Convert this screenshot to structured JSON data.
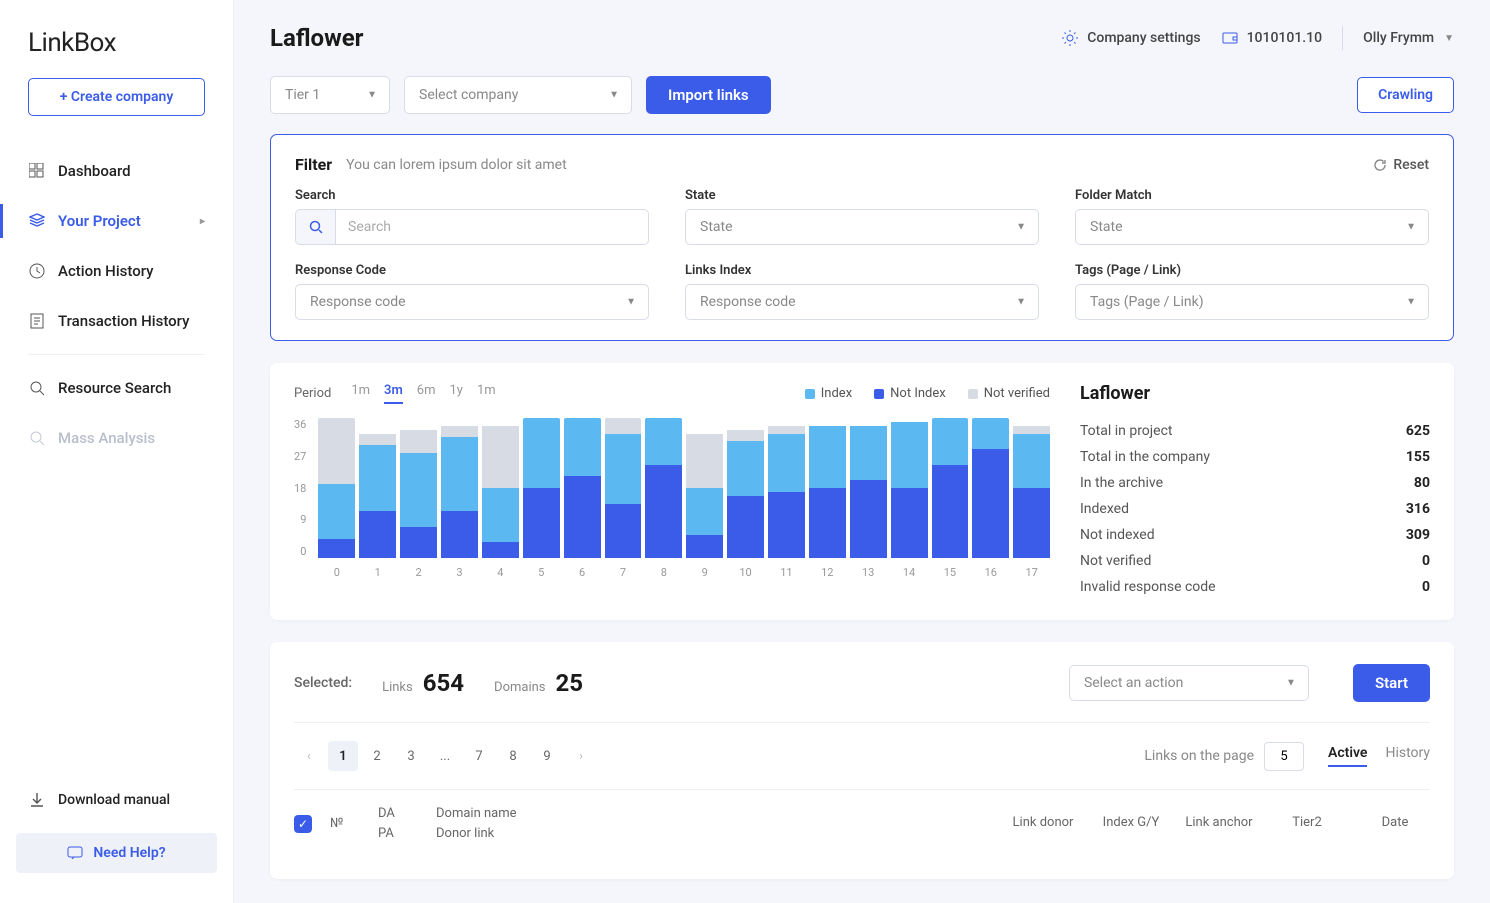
{
  "logo": "LinkBox",
  "create_company": "+ Create company",
  "nav": {
    "dashboard": "Dashboard",
    "your_project": "Your Project",
    "action_history": "Action History",
    "transaction_history": "Transaction History",
    "resource_search": "Resource Search",
    "mass_analysis": "Mass Analysis",
    "download_manual": "Download manual",
    "need_help": "Need Help?"
  },
  "header": {
    "title": "Laflower",
    "company_settings": "Company settings",
    "wallet": "1010101.10",
    "user": "Olly Frymm"
  },
  "toolbar": {
    "tier": "Tier 1",
    "company_placeholder": "Select company",
    "import": "Import links",
    "crawling": "Crawling"
  },
  "filter": {
    "title": "Filter",
    "subtitle": "You can lorem ipsum dolor sit amet",
    "reset": "Reset",
    "search_label": "Search",
    "search_placeholder": "Search",
    "state_label": "State",
    "state_placeholder": "State",
    "folder_label": "Folder Match",
    "folder_placeholder": "State",
    "response_label": "Response Code",
    "response_placeholder": "Response code",
    "links_index_label": "Links Index",
    "links_index_placeholder": "Response code",
    "tags_label": "Tags (Page / Link)",
    "tags_placeholder": "Tags (Page / Link)"
  },
  "chart": {
    "period_label": "Period",
    "periods": [
      "1m",
      "3m",
      "6m",
      "1y",
      "1m"
    ],
    "active_period": "3m",
    "legend": {
      "index": "Index",
      "not_index": "Not Index",
      "not_verified": "Not verified"
    },
    "colors": {
      "index": "#5cb8f0",
      "not_index": "#3b5ce8",
      "not_verified": "#d7dbe3"
    },
    "yticks": [
      "36",
      "27",
      "18",
      "9",
      "0"
    ]
  },
  "chart_data": {
    "type": "bar",
    "ylim": [
      0,
      36
    ],
    "categories": [
      "0",
      "1",
      "2",
      "3",
      "4",
      "5",
      "6",
      "7",
      "8",
      "9",
      "10",
      "11",
      "12",
      "13",
      "14",
      "15",
      "16",
      "17"
    ],
    "series": [
      {
        "name": "Not Index",
        "values": [
          5,
          12,
          8,
          12,
          4,
          18,
          21,
          14,
          24,
          6,
          16,
          17,
          18,
          20,
          18,
          24,
          28,
          18
        ]
      },
      {
        "name": "Index",
        "values": [
          14,
          17,
          19,
          19,
          14,
          18,
          15,
          18,
          12,
          12,
          14,
          15,
          16,
          14,
          17,
          12,
          8,
          14
        ]
      },
      {
        "name": "Not verified",
        "values": [
          17,
          3,
          6,
          3,
          16,
          0,
          0,
          4,
          0,
          14,
          3,
          2,
          0,
          0,
          0,
          0,
          0,
          2
        ]
      }
    ]
  },
  "stats": {
    "title": "Laflower",
    "rows": [
      {
        "label": "Total in project",
        "value": "625"
      },
      {
        "label": "Total in the company",
        "value": "155"
      },
      {
        "label": "In the archive",
        "value": "80"
      },
      {
        "label": "Indexed",
        "value": "316"
      },
      {
        "label": "Not indexed",
        "value": "309"
      },
      {
        "label": "Not verified",
        "value": "0"
      },
      {
        "label": "Invalid response code",
        "value": "0"
      }
    ]
  },
  "table": {
    "selected_label": "Selected:",
    "links_label": "Links",
    "links_value": "654",
    "domains_label": "Domains",
    "domains_value": "25",
    "action_placeholder": "Select an action",
    "start": "Start",
    "pages": [
      "1",
      "2",
      "3",
      "...",
      "7",
      "8",
      "9"
    ],
    "links_on_page_label": "Links on the page",
    "links_on_page_value": "5",
    "tabs": {
      "active": "Active",
      "history": "History"
    },
    "head": {
      "num": "№",
      "da": "DA",
      "pa": "PA",
      "domain": "Domain name",
      "donor": "Donor link",
      "link_donor": "Link donor",
      "index_gy": "Index G/Y",
      "link_anchor": "Link anchor",
      "tier2": "Tier2",
      "date": "Date"
    }
  }
}
